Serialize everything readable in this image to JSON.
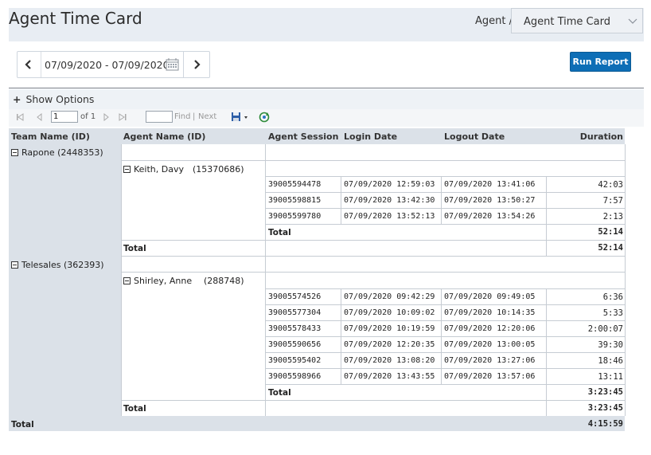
{
  "header": {
    "title": "Agent Time Card",
    "breadcrumb": "Agent /",
    "report_select_value": "Agent Time Card"
  },
  "toolbar": {
    "date_range": "07/09/2020 - 07/09/2020",
    "run_report_label": "Run Report",
    "show_options_label": "Show Options",
    "page_value": "1",
    "page_of": "of 1",
    "find_label": "Find",
    "separator": "|",
    "next_label": "Next"
  },
  "report": {
    "columns": [
      "Team Name (ID)",
      "Agent Name (ID)",
      "Agent Session",
      "Login Date",
      "Logout Date",
      "Duration"
    ],
    "teams": [
      {
        "name": "Rapone (2448353)",
        "agents": [
          {
            "name": "Keith, Davy",
            "id": "(15370686)",
            "sessions": [
              {
                "session": "39005594478",
                "login": "07/09/2020 12:59:03",
                "logout": "07/09/2020 13:41:06",
                "duration": "42:03"
              },
              {
                "session": "39005598815",
                "login": "07/09/2020 13:42:30",
                "logout": "07/09/2020 13:50:27",
                "duration": "7:57"
              },
              {
                "session": "39005599780",
                "login": "07/09/2020 13:52:13",
                "logout": "07/09/2020 13:54:26",
                "duration": "2:13"
              }
            ],
            "session_total_label": "Total",
            "session_total": "52:14"
          }
        ],
        "agent_total_label": "Total",
        "agent_total": "52:14"
      },
      {
        "name": "Telesales (362393)",
        "agents": [
          {
            "name": "Shirley, Anne",
            "id": "(288748)",
            "sessions": [
              {
                "session": "39005574526",
                "login": "07/09/2020 09:42:29",
                "logout": "07/09/2020 09:49:05",
                "duration": "6:36"
              },
              {
                "session": "39005577304",
                "login": "07/09/2020 10:09:02",
                "logout": "07/09/2020 10:14:35",
                "duration": "5:33"
              },
              {
                "session": "39005578433",
                "login": "07/09/2020 10:19:59",
                "logout": "07/09/2020 12:20:06",
                "duration": "2:00:07"
              },
              {
                "session": "39005590656",
                "login": "07/09/2020 12:20:35",
                "logout": "07/09/2020 13:00:05",
                "duration": "39:30"
              },
              {
                "session": "39005595402",
                "login": "07/09/2020 13:08:20",
                "logout": "07/09/2020 13:27:06",
                "duration": "18:46"
              },
              {
                "session": "39005598966",
                "login": "07/09/2020 13:43:55",
                "logout": "07/09/2020 13:57:06",
                "duration": "13:11"
              }
            ],
            "session_total_label": "Total",
            "session_total": "3:23:45"
          }
        ],
        "agent_total_label": "Total",
        "agent_total": "3:23:45"
      }
    ],
    "grand_total_label": "Total",
    "grand_total": "4:15:59"
  }
}
